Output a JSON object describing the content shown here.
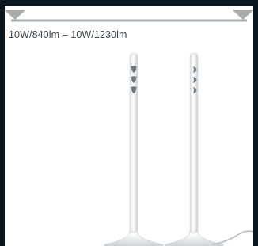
{
  "spec": {
    "range_label": "10W/840lm – 10W/1230lm"
  },
  "colors": {
    "background": "#0b1720",
    "panel": "#ffffff",
    "bar": "#a7acaf",
    "lamp": "#eef1f3",
    "led": "#6f787e"
  }
}
